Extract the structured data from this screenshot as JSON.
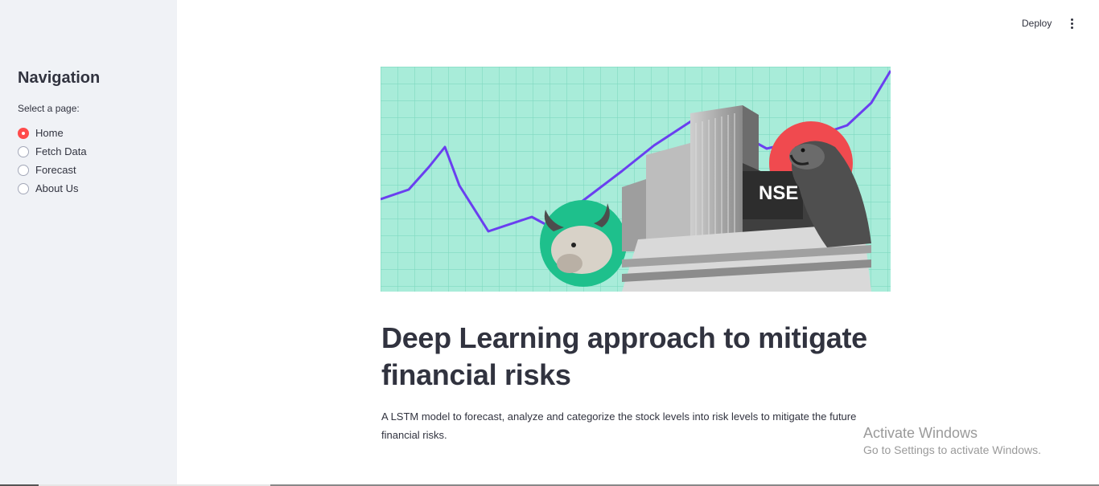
{
  "sidebar": {
    "title": "Navigation",
    "select_label": "Select a page:",
    "options": [
      "Home",
      "Fetch Data",
      "Forecast",
      "About Us"
    ],
    "selected": "Home"
  },
  "header": {
    "deploy_label": "Deploy",
    "menu_icon": "kebab-menu-icon"
  },
  "hero": {
    "building_sign": "NSE"
  },
  "main": {
    "title": "Deep Learning approach to mitigate financial risks",
    "description": "A LSTM model to forecast, analyze and categorize the stock levels into risk levels to mitigate the future financial risks."
  },
  "watermark": {
    "title": "Activate Windows",
    "subtitle": "Go to Settings to activate Windows."
  },
  "colors": {
    "accent": "#ff4b4b",
    "sidebar_bg": "#f0f2f6",
    "text": "#31333f",
    "hero_bg": "#a8ecd9",
    "trend_line": "#6a3ff0",
    "bull_circle": "#1ec08c",
    "bear_circle": "#f04a4f"
  }
}
